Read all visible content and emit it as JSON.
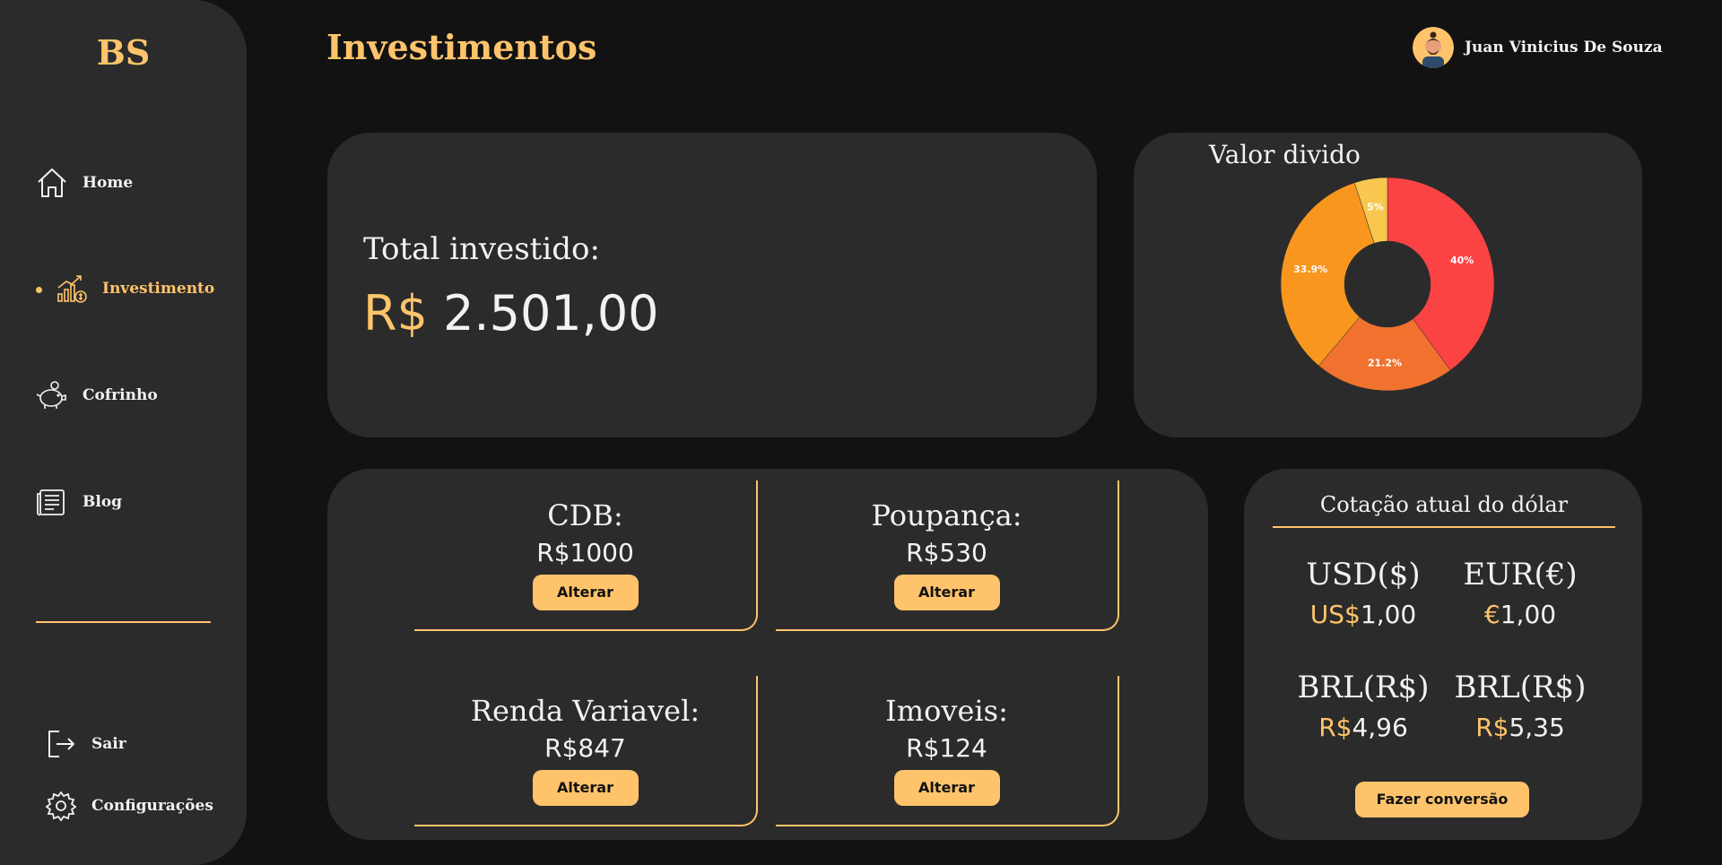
{
  "brand": {
    "logo": "BS"
  },
  "sidebar": {
    "items": [
      {
        "label": "Home",
        "icon": "home-icon"
      },
      {
        "label": "Investimento",
        "icon": "investment-chart-icon",
        "active": true
      },
      {
        "label": "Cofrinho",
        "icon": "piggy-bank-icon"
      },
      {
        "label": "Blog",
        "icon": "blog-document-icon"
      }
    ],
    "bottom": [
      {
        "label": "Sair",
        "icon": "logout-icon"
      },
      {
        "label": "Configurações",
        "icon": "gear-icon"
      }
    ]
  },
  "header": {
    "title": "Investimentos",
    "user_name": "Juan Vinicius De Souza"
  },
  "total": {
    "label": "Total investido:",
    "currency": "R$",
    "value": "2.501,00"
  },
  "chart_card": {
    "title": "Valor divido"
  },
  "chart_data": {
    "type": "pie",
    "categories": [
      "CDB",
      "Poupança",
      "Renda Variavel",
      "Imoveis"
    ],
    "values": [
      40,
      21.2,
      33.9,
      5
    ],
    "labels": [
      "40%",
      "21.2%",
      "33.9%",
      "5%"
    ],
    "colors": [
      "#fb4343",
      "#f1722f",
      "#f8961e",
      "#f9c74f"
    ],
    "donut": true
  },
  "investments": [
    {
      "name": "CDB:",
      "value": "R$1000",
      "button": "Alterar"
    },
    {
      "name": "Poupança:",
      "value": "R$530",
      "button": "Alterar"
    },
    {
      "name": "Renda Variavel:",
      "value": "R$847",
      "button": "Alterar"
    },
    {
      "name": "Imoveis:",
      "value": "R$124",
      "button": "Alterar"
    }
  ],
  "dollar": {
    "title": "Cotação atual do dólar",
    "cells": [
      {
        "code": "USD($)",
        "symbol": "US$",
        "amount": "1,00"
      },
      {
        "code": "EUR(€)",
        "symbol": "€",
        "amount": "1,00"
      },
      {
        "code": "BRL(R$)",
        "symbol": "R$",
        "amount": "4,96"
      },
      {
        "code": "BRL(R$)",
        "symbol": "R$",
        "amount": "5,35"
      }
    ],
    "button": "Fazer conversão"
  },
  "colors": {
    "accent": "#ffc46b",
    "card": "#2b2b2b",
    "background": "#121212"
  }
}
